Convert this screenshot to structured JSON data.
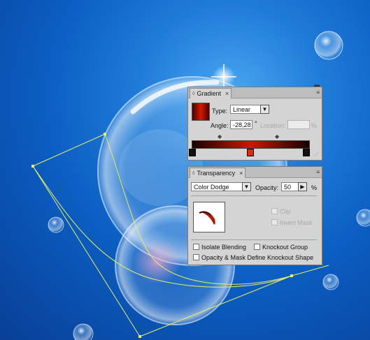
{
  "gradient_panel": {
    "tab_label": "Gradient",
    "type_label": "Type:",
    "type_value": "Linear",
    "angle_label": "Angle:",
    "angle_value": "-28,28",
    "angle_unit": "°",
    "location_label": "Location:",
    "location_unit": "%",
    "gradient_start_color": "#1a0000",
    "gradient_mid_color": "#cc1800",
    "gradient_end_color": "#120000"
  },
  "transparency_panel": {
    "tab_label": "Transparency",
    "blend_mode": "Color Dodge",
    "opacity_label": "Opacity:",
    "opacity_value": "50",
    "opacity_unit": "%",
    "clip_label": "Clip",
    "invert_mask_label": "Invert Mask",
    "isolate_blending_label": "Isolate Blending",
    "knockout_group_label": "Knockout Group",
    "opacity_mask_label": "Opacity & Mask Define Knockout Shape"
  },
  "icons": {
    "panel_tab": "diamond",
    "close": "×",
    "panel_menu": "≡",
    "dropdown": "▼",
    "stepper": "▶"
  },
  "colors": {
    "background_blue": "#0b5ec2",
    "path_yellow": "#e8f060"
  }
}
